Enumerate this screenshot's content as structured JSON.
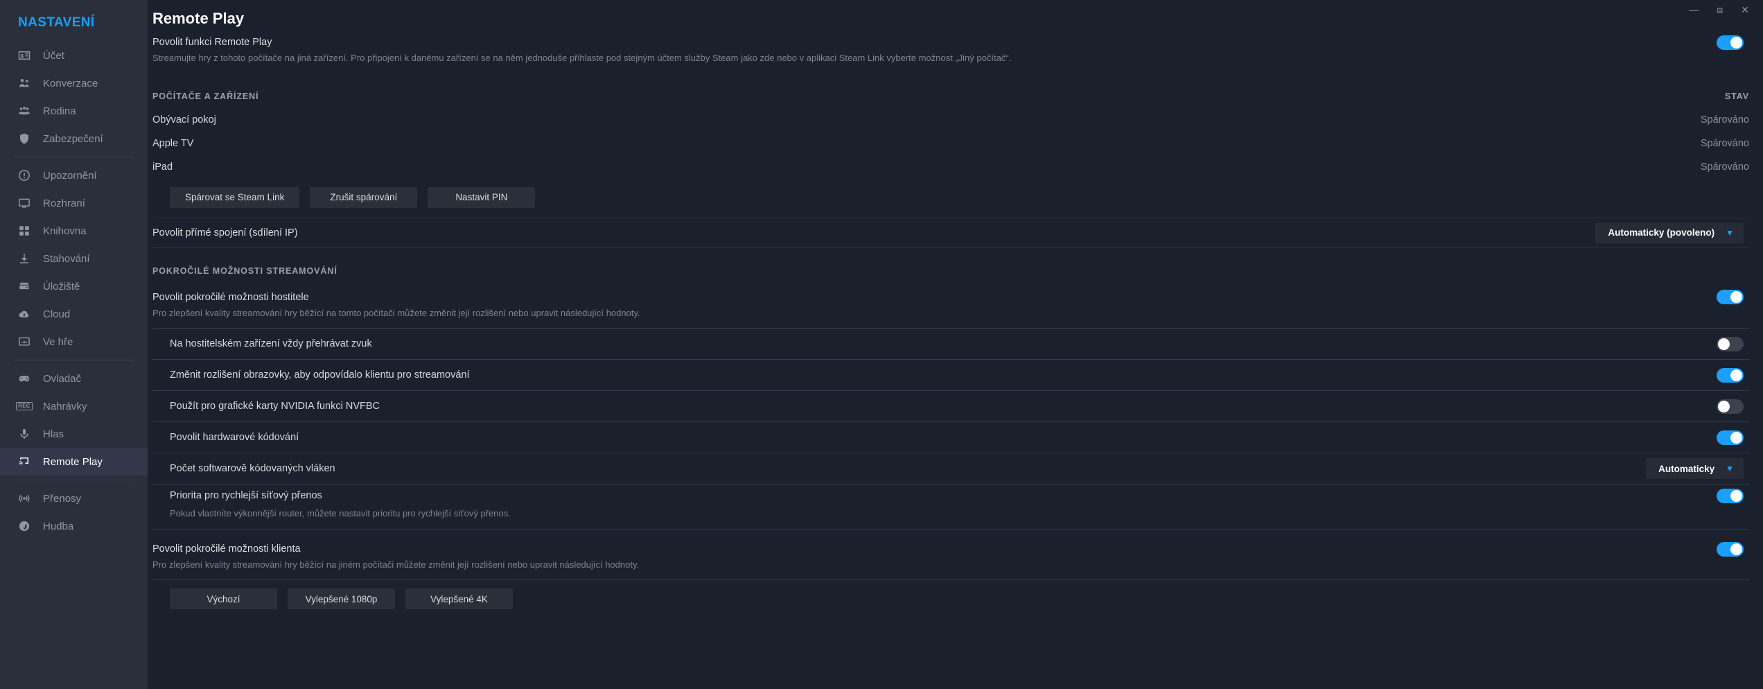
{
  "window": {
    "minimize": "minimize-icon",
    "maximize": "maximize-icon",
    "close": "close-icon"
  },
  "sidebar": {
    "title": "NASTAVENÍ",
    "items": [
      {
        "label": "Účet",
        "icon": "account-card-icon",
        "active": false
      },
      {
        "label": "Konverzace",
        "icon": "friends-icon",
        "active": false
      },
      {
        "label": "Rodina",
        "icon": "family-icon",
        "active": false
      },
      {
        "label": "Zabezpečení",
        "icon": "shield-icon",
        "active": false
      },
      {
        "label": "Upozornění",
        "icon": "bell-alert-icon",
        "active": false
      },
      {
        "label": "Rozhraní",
        "icon": "monitor-icon",
        "active": false
      },
      {
        "label": "Knihovna",
        "icon": "grid-icon",
        "active": false
      },
      {
        "label": "Stahování",
        "icon": "download-icon",
        "active": false
      },
      {
        "label": "Úložiště",
        "icon": "drive-icon",
        "active": false
      },
      {
        "label": "Cloud",
        "icon": "cloud-sync-icon",
        "active": false
      },
      {
        "label": "Ve hře",
        "icon": "ingame-icon",
        "active": false
      },
      {
        "label": "Ovladač",
        "icon": "gamepad-icon",
        "active": false
      },
      {
        "label": "Nahrávky",
        "icon": "rec-icon",
        "active": false
      },
      {
        "label": "Hlas",
        "icon": "microphone-icon",
        "active": false
      },
      {
        "label": "Remote Play",
        "icon": "cast-icon",
        "active": true
      },
      {
        "label": "Přenosy",
        "icon": "broadcast-icon",
        "active": false
      },
      {
        "label": "Hudba",
        "icon": "music-note-icon",
        "active": false
      }
    ]
  },
  "page": {
    "title": "Remote Play",
    "enable_remote_play": {
      "label": "Povolit funkci Remote Play",
      "description": "Streamujte hry z tohoto počítače na jiná zařízení. Pro připojení k danému zařízení se na něm jednoduše přihlaste pod stejným účtem služby Steam jako zde nebo v aplikaci Steam Link vyberte možnost „Jiný počítač“.",
      "toggle": "on"
    },
    "devices_section": {
      "heading": "POČÍTAČE A ZAŘÍZENÍ",
      "status_column": "STAV",
      "devices": [
        {
          "name": "Obývací pokoj",
          "status": "Spárováno"
        },
        {
          "name": "Apple TV",
          "status": "Spárováno"
        },
        {
          "name": "iPad",
          "status": "Spárováno"
        }
      ],
      "buttons": [
        "Spárovat se Steam Link",
        "Zrušit spárování",
        "Nastavit PIN"
      ],
      "direct_connection": {
        "label": "Povolit přímé spojení (sdílení IP)",
        "value": "Automaticky (povoleno)",
        "chevron": "chevron-down-icon"
      }
    },
    "advanced_section": {
      "heading": "POKROČILÉ MOŽNOSTI STREAMOVÁNÍ",
      "host_options": {
        "label": "Povolit pokročilé možnosti hostitele",
        "description": "Pro zlepšení kvality streamování hry běžící na tomto počítači můžete změnit její rozlišení nebo upravit následující hodnoty.",
        "toggle": "on"
      },
      "options": [
        {
          "label": "Na hostitelském zařízení vždy přehrávat zvuk",
          "control": "toggle",
          "toggle": "off"
        },
        {
          "label": "Změnit rozlišení obrazovky, aby odpovídalo klientu pro streamování",
          "control": "toggle",
          "toggle": "on"
        },
        {
          "label": "Použít pro grafické karty NVIDIA funkci NVFBC",
          "control": "toggle",
          "toggle": "off"
        },
        {
          "label": "Povolit hardwarové kódování",
          "control": "toggle",
          "toggle": "on"
        },
        {
          "label": "Počet softwarově kódovaných vláken",
          "control": "dropdown",
          "value": "Automaticky",
          "chevron": "chevron-down-icon"
        }
      ],
      "priority": {
        "label": "Priorita pro rychlejší síťový přenos",
        "description": "Pokud vlastníte výkonnější router, můžete nastavit prioritu pro rychlejší síťový přenos.",
        "toggle": "on"
      },
      "client_options": {
        "label": "Povolit pokročilé možnosti klienta",
        "description": "Pro zlepšení kvality streamování hry běžící na jiném počítači můžete změnit její rozlišení nebo upravit následující hodnoty.",
        "toggle": "on",
        "buttons": [
          "Výchozí",
          "Vylepšené 1080p",
          "Vylepšené 4K"
        ]
      }
    }
  },
  "colors": {
    "accent": "#1a9fff",
    "sidebar_bg": "#2a2f3a",
    "main_bg": "#1a212c",
    "active_bg": "#32384a"
  }
}
